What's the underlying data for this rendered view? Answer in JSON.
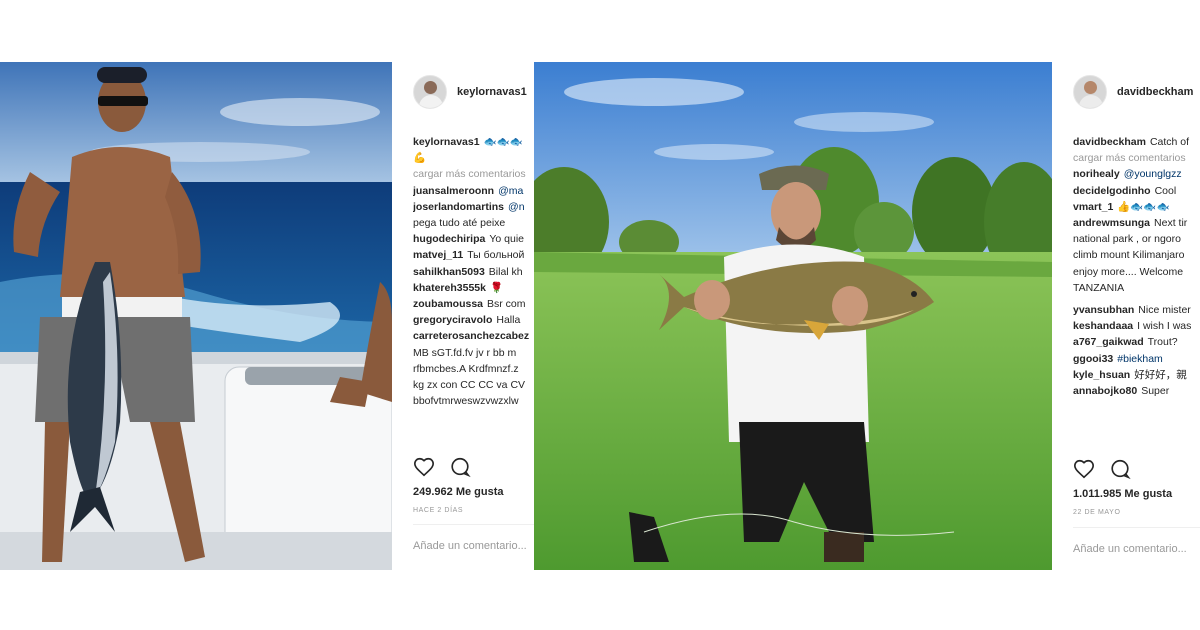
{
  "post1": {
    "username": "keylornavas1",
    "caption_user": "keylornavas1",
    "caption_text": "🐟🐟🐟",
    "caption_text2": "💪",
    "load_more": "cargar más comentarios",
    "comments": [
      {
        "user": "juansalmeroonn",
        "text": "@ma"
      },
      {
        "user": "joserlandomartins",
        "text": "@n"
      },
      {
        "user": "",
        "text": "pega tudo até peixe"
      },
      {
        "user": "hugodechiripa",
        "text": "Yo quie"
      },
      {
        "user": "matvej_11",
        "text": "Ты больной"
      },
      {
        "user": "sahilkhan5093",
        "text": "Bilal kh"
      },
      {
        "user": "khatereh3555k",
        "text": "🌹"
      },
      {
        "user": "zoubamoussa",
        "text": "Bsr com"
      },
      {
        "user": "gregoryciravolo",
        "text": "Halla"
      },
      {
        "user": "carreterosanchezcabez",
        "text": ""
      },
      {
        "user": "",
        "text": "MB sGT.fd.fv jv r bb m"
      },
      {
        "user": "",
        "text": "rfbmcbes.A Krdfmnzf.z"
      },
      {
        "user": "",
        "text": "kg zx con CC CC va CV"
      },
      {
        "user": "",
        "text": "bbofvtmrweswzvwzxlw"
      }
    ],
    "likes": "249.962 Me gusta",
    "date": "HACE 2 DÍAS",
    "add_comment_placeholder": "Añade un comentario..."
  },
  "post2": {
    "username": "davidbeckham",
    "caption_user": "davidbeckham",
    "caption_text": "Catch of",
    "load_more": "cargar más comentarios",
    "comments": [
      {
        "user": "norihealy",
        "text": "@younglgzz",
        "link": true
      },
      {
        "user": "decidelgodinho",
        "text": "Cool"
      },
      {
        "user": "vmart_1",
        "text": "👍🐟🐟🐟"
      },
      {
        "user": "andrewmsunga",
        "text": "Next tir"
      },
      {
        "user": "",
        "text": "national park , or ngoro"
      },
      {
        "user": "",
        "text": "climb mount Kilimanjaro"
      },
      {
        "user": "",
        "text": "enjoy more.... Welcome"
      },
      {
        "user": "",
        "text": "TANZANIA"
      },
      {
        "user": "yvansubhan",
        "text": "Nice mister"
      },
      {
        "user": "keshandaaa",
        "text": "I wish I was"
      },
      {
        "user": "a767_gaikwad",
        "text": "Trout?"
      },
      {
        "user": "ggooi33",
        "text": "#biekham",
        "link": true
      },
      {
        "user": "kyle_hsuan",
        "text": "好好好，親"
      },
      {
        "user": "annabojko80",
        "text": "Super"
      }
    ],
    "likes": "1.011.985 Me gusta",
    "date": "22 DE MAYO",
    "add_comment_placeholder": "Añade un comentario..."
  }
}
